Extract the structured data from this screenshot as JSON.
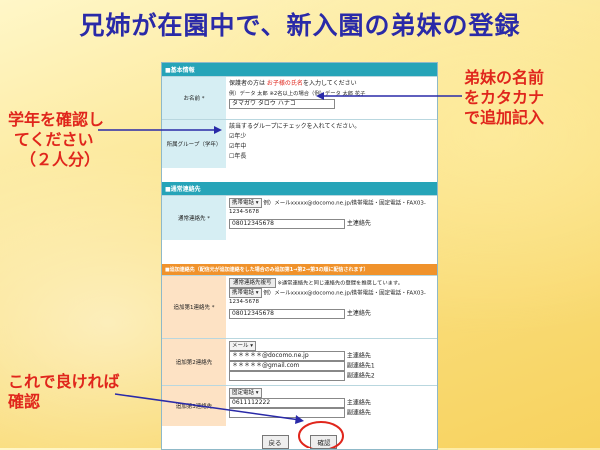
{
  "title": "兄姉が在園中で、新入園の弟妹の登録",
  "form": {
    "basic_header": "■基本情報",
    "name_label": "お名前 *",
    "name_note_prefix": "保護者の方は ",
    "name_note_red": "お子様の氏名",
    "name_note_suffix": "を入力してください",
    "name_example": "例）データ 太郎 ※2名以上の場合（例）データ 太郎 花子",
    "name_value": "タマガワ タロウ ハナコ",
    "group_label": "所属グループ（学年）",
    "group_note": "該当するグループにチェックを入れてください。",
    "groups": [
      {
        "label": "年少",
        "checked": true
      },
      {
        "label": "年中",
        "checked": true
      },
      {
        "label": "年長",
        "checked": false
      }
    ],
    "contact_header": "■通常連絡先",
    "contact_label": "通常連絡先 *",
    "contact_select": "携帯電話",
    "contact_example": "例）メールxxxxx@docomo.ne.jp/携帯電話・固定電話・FAX03-1234-5678",
    "contact_value": "08012345678",
    "contact_main": "主連絡先",
    "emergency_header": "■追加連絡先（配信元が追加連絡をした場合のみ追加第1→第2→第3の順に配信されます）",
    "add1_label": "追加第1連絡先 *",
    "add1_button": "通常連絡先複写",
    "add1_note": "※通常連絡先と同じ連絡先の登録を推奨しています。",
    "add1_select": "携帯電話",
    "add1_example": "例）メールxxxxx@docomo.ne.jp/携帯電話・固定電話・FAX03-1234-5678",
    "add1_value": "08012345678",
    "add1_main": "主連絡先",
    "add2_label": "追加第2連絡先",
    "add2_select": "メール",
    "add2_values": [
      "＊＊＊＊＊@docomo.ne.jp",
      "＊＊＊＊＊@gmail.com",
      ""
    ],
    "add2_tags": [
      "主連絡先",
      "副連絡先1",
      "副連絡先2"
    ],
    "add3_label": "追加第3連絡先",
    "add3_select": "固定電話",
    "add3_values": [
      "0611112222",
      ""
    ],
    "add3_tags": [
      "主連絡先",
      "副連絡先"
    ],
    "back_button": "戻る",
    "confirm_button": "確認"
  },
  "annotations": {
    "right": [
      "弟妹の名前",
      "をカタカナ",
      "で追加記入"
    ],
    "left": [
      "学年を確認し",
      "てください",
      "（２人分）"
    ],
    "bottom": [
      "これで良ければ",
      "確認"
    ]
  },
  "colors": {
    "title": "#2a2aa8",
    "annotation": "#e0261c",
    "arrow": "#2a2aa8"
  }
}
